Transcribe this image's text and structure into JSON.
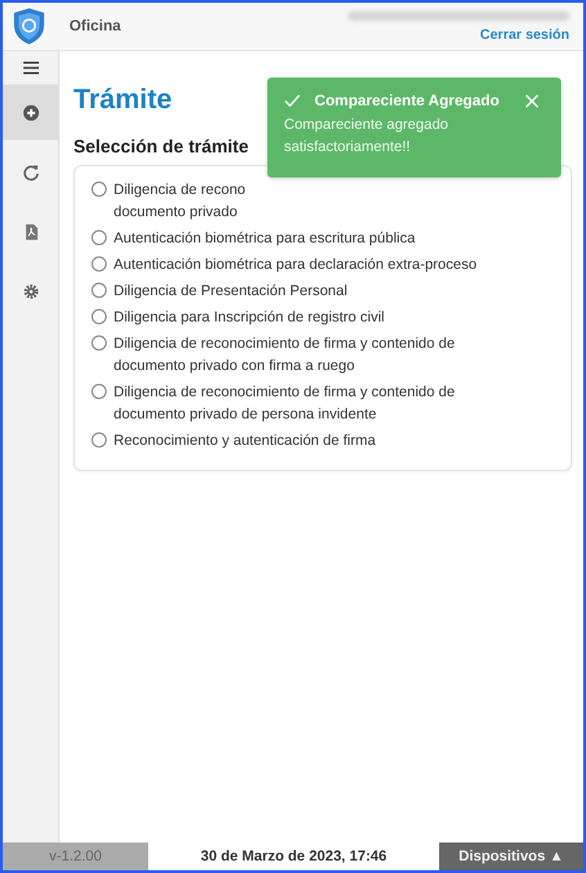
{
  "header": {
    "title": "Oficina",
    "logout_link": "Cerrar sesión"
  },
  "sidebar": {
    "items": [
      {
        "kind": "plus",
        "selected": true
      },
      {
        "kind": "refresh",
        "selected": false
      },
      {
        "kind": "pdf",
        "selected": false
      },
      {
        "kind": "gear",
        "selected": false
      }
    ]
  },
  "page_title": "Trámite",
  "section_title": "Selección de trámite",
  "options": [
    {
      "lines": [
        "Diligencia de recono",
        "documento privado"
      ],
      "selected": false
    },
    {
      "lines": [
        "Autenticación biométrica para escritura pública"
      ],
      "selected": false
    },
    {
      "lines": [
        "Autenticación biométrica para declaración extra-proceso"
      ],
      "selected": false
    },
    {
      "lines": [
        "Diligencia de Presentación Personal"
      ],
      "selected": false
    },
    {
      "lines": [
        "Diligencia para Inscripción de registro civil"
      ],
      "selected": false
    },
    {
      "lines": [
        "Diligencia de reconocimiento de firma y contenido de",
        "documento privado con firma a ruego"
      ],
      "selected": false
    },
    {
      "lines": [
        "Diligencia de reconocimiento de firma y contenido de",
        "documento privado de persona invidente"
      ],
      "selected": false
    },
    {
      "lines": [
        "Reconocimiento y autenticación de firma"
      ],
      "selected": false
    }
  ],
  "toast": {
    "title": "Compareciente Agregado",
    "message": "Compareciente agregado satisfactoriamente!!"
  },
  "footer": {
    "version": "v-1.2.00",
    "datetime": "30 de Marzo de 2023, 17:46",
    "devices_button": "Dispositivos ▲"
  }
}
